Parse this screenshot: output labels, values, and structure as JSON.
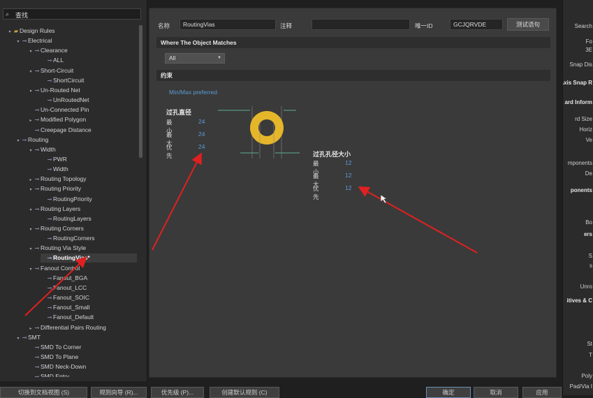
{
  "search": {
    "value": "查找"
  },
  "tree": [
    {
      "label": "Design Rules",
      "level": 0,
      "arrow": "▾",
      "icon": "folder"
    },
    {
      "label": "Electrical",
      "level": 1,
      "arrow": "▾",
      "icon": "rule"
    },
    {
      "label": "Clearance",
      "level": 2,
      "arrow": "▾",
      "icon": "rule"
    },
    {
      "label": "ALL",
      "level": 3,
      "arrow": "",
      "icon": "rule"
    },
    {
      "label": "Short-Circuit",
      "level": 2,
      "arrow": "▾",
      "icon": "rule"
    },
    {
      "label": "ShortCircuit",
      "level": 3,
      "arrow": "",
      "icon": "rule"
    },
    {
      "label": "Un-Routed Net",
      "level": 2,
      "arrow": "▾",
      "icon": "rule"
    },
    {
      "label": "UnRoutedNet",
      "level": 3,
      "arrow": "",
      "icon": "rule"
    },
    {
      "label": "Un-Connected Pin",
      "level": 2,
      "arrow": "",
      "icon": "rule"
    },
    {
      "label": "Modified Polygon",
      "level": 2,
      "arrow": "▸",
      "icon": "rule"
    },
    {
      "label": "Creepage Distance",
      "level": 2,
      "arrow": "",
      "icon": "rule"
    },
    {
      "label": "Routing",
      "level": 1,
      "arrow": "▾",
      "icon": "rule"
    },
    {
      "label": "Width",
      "level": 2,
      "arrow": "▾",
      "icon": "rule"
    },
    {
      "label": "PWR",
      "level": 3,
      "arrow": "",
      "icon": "rule"
    },
    {
      "label": "Width",
      "level": 3,
      "arrow": "",
      "icon": "rule"
    },
    {
      "label": "Routing Topology",
      "level": 2,
      "arrow": "▸",
      "icon": "rule"
    },
    {
      "label": "Routing Priority",
      "level": 2,
      "arrow": "▾",
      "icon": "rule"
    },
    {
      "label": "RoutingPriority",
      "level": 3,
      "arrow": "",
      "icon": "rule"
    },
    {
      "label": "Routing Layers",
      "level": 2,
      "arrow": "▾",
      "icon": "rule"
    },
    {
      "label": "RoutingLayers",
      "level": 3,
      "arrow": "",
      "icon": "rule"
    },
    {
      "label": "Routing Corners",
      "level": 2,
      "arrow": "▾",
      "icon": "rule"
    },
    {
      "label": "RoutingCorners",
      "level": 3,
      "arrow": "",
      "icon": "rule"
    },
    {
      "label": "Routing Via Style",
      "level": 2,
      "arrow": "▾",
      "icon": "rule"
    },
    {
      "label": "RoutingVias*",
      "level": 3,
      "arrow": "",
      "icon": "rule",
      "selected": true
    },
    {
      "label": "Fanout Control",
      "level": 2,
      "arrow": "▾",
      "icon": "rule"
    },
    {
      "label": "Fanout_BGA",
      "level": 3,
      "arrow": "",
      "icon": "rule"
    },
    {
      "label": "Fanout_LCC",
      "level": 3,
      "arrow": "",
      "icon": "rule"
    },
    {
      "label": "Fanout_SOIC",
      "level": 3,
      "arrow": "",
      "icon": "rule"
    },
    {
      "label": "Fanout_Small",
      "level": 3,
      "arrow": "",
      "icon": "rule"
    },
    {
      "label": "Fanout_Default",
      "level": 3,
      "arrow": "",
      "icon": "rule"
    },
    {
      "label": "Differential Pairs Routing",
      "level": 2,
      "arrow": "▸",
      "icon": "rule"
    },
    {
      "label": "SMT",
      "level": 1,
      "arrow": "▾",
      "icon": "rule"
    },
    {
      "label": "SMD To Corner",
      "level": 2,
      "arrow": "",
      "icon": "rule"
    },
    {
      "label": "SMD To Plane",
      "level": 2,
      "arrow": "",
      "icon": "rule"
    },
    {
      "label": "SMD Neck-Down",
      "level": 2,
      "arrow": "",
      "icon": "rule"
    },
    {
      "label": "SMD Entry",
      "level": 2,
      "arrow": "",
      "icon": "rule"
    }
  ],
  "rule_header": {
    "name_label": "名称",
    "name_value": "RoutingVias",
    "comment_label": "注释",
    "comment_value": "",
    "id_label": "唯一ID",
    "id_value": "GCJQRVDE",
    "test_button": "测试语句"
  },
  "where_matches": {
    "title": "Where The Object Matches",
    "scope": "All"
  },
  "constraints": {
    "title": "约束",
    "mode_label": "Min/Max preferred",
    "via_diameter": {
      "title": "过孔直径",
      "min_label": "最小",
      "min": "24",
      "max_label": "最大",
      "max": "24",
      "pref_label": "优先",
      "pref": "24"
    },
    "via_hole": {
      "title": "过孔孔径大小",
      "min_label": "最小",
      "min": "12",
      "max_label": "最大",
      "max": "12",
      "pref_label": "优先",
      "pref": "12"
    }
  },
  "right_panel": {
    "items": [
      "Search",
      "Fo",
      "3E",
      "Snap Dis",
      "Axis Snap R",
      "ard Inform",
      "rd Size",
      "Horiz",
      "Ve",
      "mponents",
      "De",
      "ponents",
      "Bo",
      "ers",
      "S",
      "s",
      "Unro",
      "itives & C",
      "St",
      "T",
      "Poly",
      "Pad/Via I"
    ]
  },
  "bottom_buttons": [
    "切换到文档视图 (S)",
    "规则向导 (R)...",
    "优先级 (P)...",
    "创建默认规则 (C)",
    "确定",
    "取消",
    "应用"
  ],
  "colors": {
    "via_ring": "#e5b62a",
    "annotation_arrow": "#e02020",
    "value_blue": "#5b9bd5"
  }
}
